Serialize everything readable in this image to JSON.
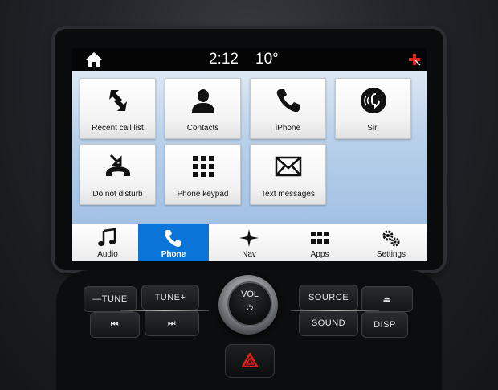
{
  "status_bar": {
    "time": "2:12",
    "temperature": "10°"
  },
  "tiles": [
    {
      "label": "Recent call list",
      "icon": "recent-calls-icon"
    },
    {
      "label": "Contacts",
      "icon": "contact-person-icon"
    },
    {
      "label": "iPhone",
      "icon": "phone-handset-icon"
    },
    {
      "label": "Siri",
      "icon": "siri-voice-icon"
    },
    {
      "label": "Do not disturb",
      "icon": "do-not-disturb-icon"
    },
    {
      "label": "Phone keypad",
      "icon": "keypad-grid-icon"
    },
    {
      "label": "Text messages",
      "icon": "envelope-icon"
    }
  ],
  "nav": [
    {
      "label": "Audio",
      "icon": "music-note-icon"
    },
    {
      "label": "Phone",
      "icon": "phone-handset-icon",
      "active": true
    },
    {
      "label": "Nav",
      "icon": "compass-star-icon"
    },
    {
      "label": "Apps",
      "icon": "apps-grid-icon"
    },
    {
      "label": "Settings",
      "icon": "gears-icon"
    }
  ],
  "controls": {
    "tune_minus": "—TUNE",
    "tune_plus": "TUNE+",
    "vol": "VOL",
    "source": "SOURCE",
    "sound": "SOUND",
    "disp": "DISP",
    "power_symbol": "⏻",
    "seek_back": "⏮",
    "seek_fwd": "⏭",
    "eject": "⏏"
  },
  "colors": {
    "active_tab": "#0a74d8",
    "status_bar": "#050505",
    "hazard": "#e0201a",
    "sos_badge": "#e0201a"
  }
}
